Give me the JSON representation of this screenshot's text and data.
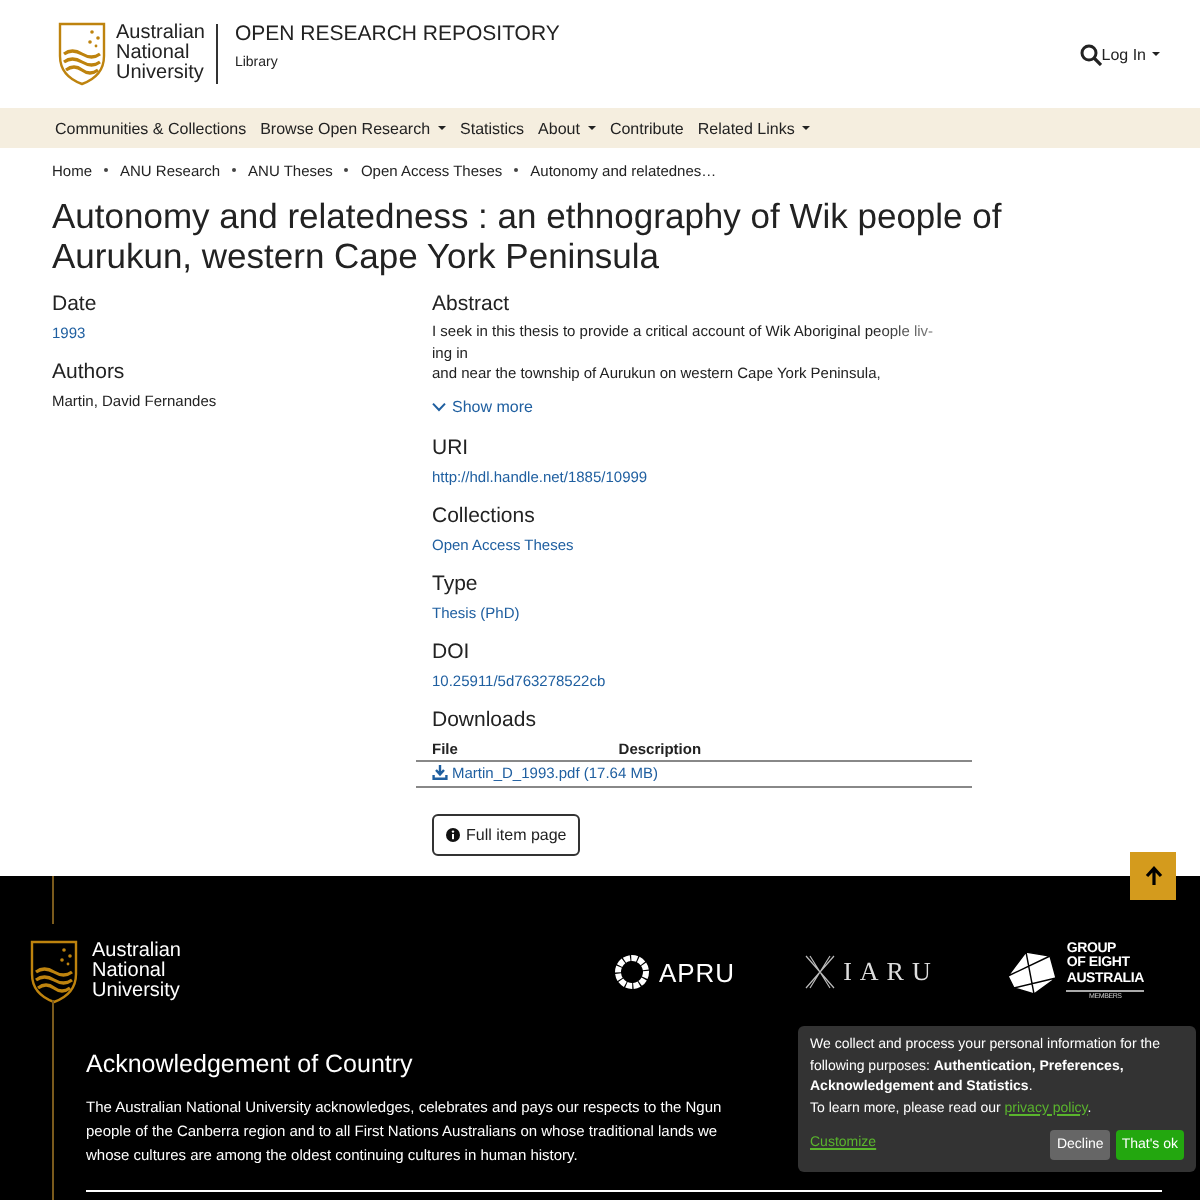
{
  "header": {
    "logo_text": [
      "Australian",
      "National",
      "University"
    ],
    "repo_title": "OPEN RESEARCH REPOSITORY",
    "repo_subtitle": "Library",
    "login": "Log In"
  },
  "nav": [
    {
      "label": "Communities & Collections",
      "dropdown": false
    },
    {
      "label": "Browse Open Research",
      "dropdown": true
    },
    {
      "label": "Statistics",
      "dropdown": false
    },
    {
      "label": "About",
      "dropdown": true
    },
    {
      "label": "Contribute",
      "dropdown": false
    },
    {
      "label": "Related Links",
      "dropdown": true
    }
  ],
  "breadcrumbs": [
    "Home",
    "ANU Research",
    "ANU Theses",
    "Open Access Theses",
    "Autonomy and relatednes…"
  ],
  "title": "Autonomy and relatedness : an ethnography of Wik people of Aurukun, western Cape York Peninsula",
  "left_fields": [
    {
      "kind": "link",
      "label": "Date",
      "value": "1993"
    },
    {
      "kind": "text",
      "label": "Authors",
      "value": "Martin, David Fernandes"
    }
  ],
  "right_fields": [
    {
      "kind": "abstract",
      "label": "Abstract",
      "lines": [
        "I seek in this thesis to provide a critical account of Wik Aboriginal people liv-",
        "ing in",
        "and near the township of Aurukun on western Cape York Peninsula,"
      ],
      "toggle": "Show more"
    },
    {
      "kind": "link",
      "label": "URI",
      "value": "http://hdl.handle.net/1885/10999"
    },
    {
      "kind": "link",
      "label": "Collections",
      "value": "Open Access Theses"
    },
    {
      "kind": "link",
      "label": "Type",
      "value": "Thesis (PhD)"
    },
    {
      "kind": "link",
      "label": "DOI",
      "value": "10.25911/5d763278522cb"
    },
    {
      "kind": "downloads",
      "label": "Downloads",
      "columns": [
        "File",
        "Description"
      ],
      "files": [
        "Martin_D_1993.pdf (17.64 MB)"
      ]
    }
  ],
  "full_item_button": "Full item page",
  "footer": {
    "logo_text": [
      "Australian",
      "National",
      "University"
    ],
    "partners": [
      {
        "kind": "apru",
        "lines": [
          "APRU"
        ]
      },
      {
        "kind": "iaru",
        "lines": [
          "IARU"
        ]
      },
      {
        "kind": "go8",
        "lines": [
          "GROUP",
          "OF EIGHT",
          "AUSTRALIA"
        ],
        "tagline": "MEMBERS"
      }
    ],
    "heading": "Acknowledgement of Country",
    "lines": [
      "The Australian National University acknowledges, celebrates and pays our respects to the Ngun",
      "people of the Canberra region and to all First Nations Australians on whose traditional lands we",
      "whose cultures are among the oldest continuing cultures in human history."
    ]
  },
  "cookie": {
    "text": "We collect and process your personal information for the following purposes: **Authentication, Preferences, Acknowledgement and Statistics**.",
    "learn": "To learn more, please read our ",
    "policy_link": "privacy policy",
    "learn_after": ".",
    "customize": "Customize",
    "decline": "Decline",
    "accept": "That's ok"
  }
}
